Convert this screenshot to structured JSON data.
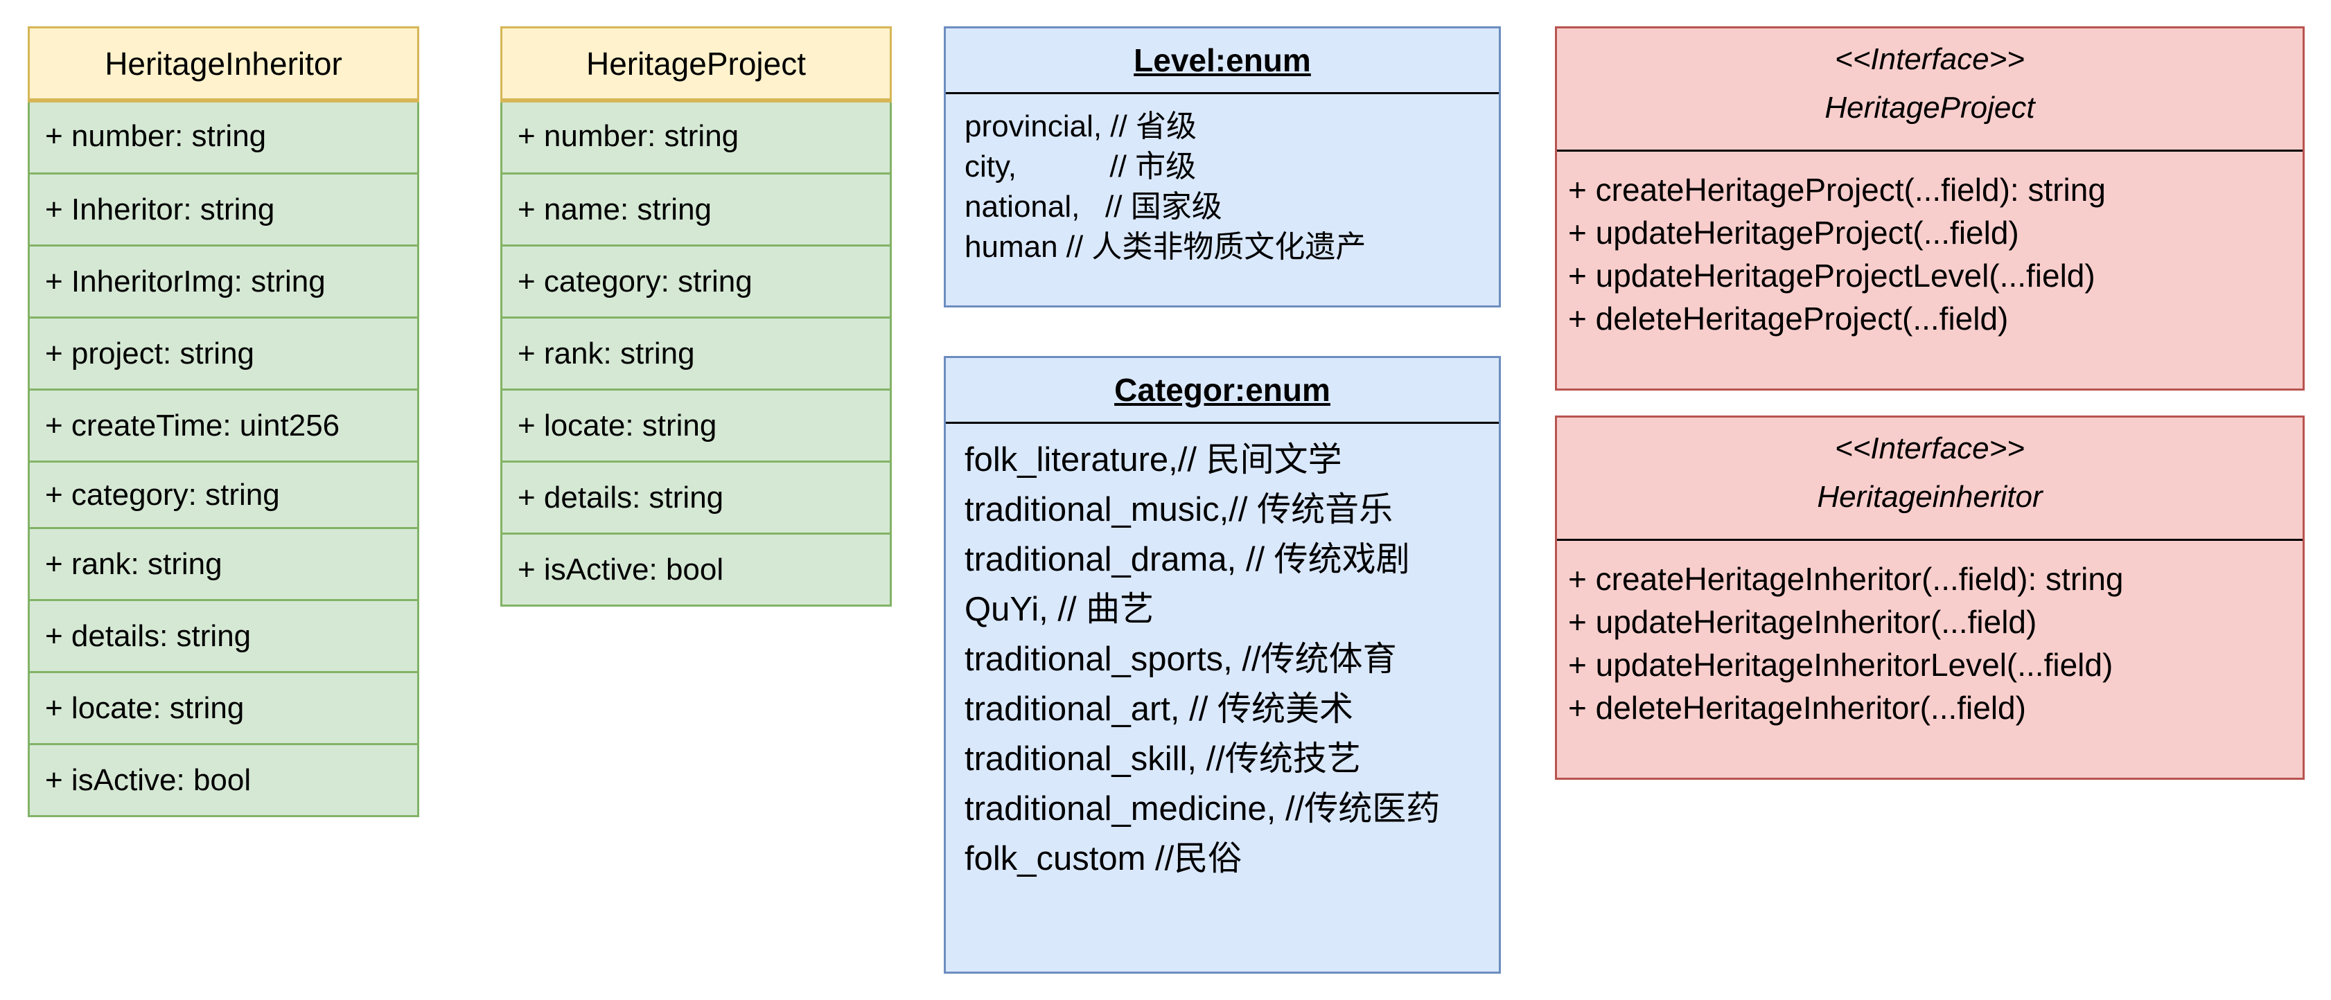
{
  "classes": {
    "inheritor": {
      "name": "HeritageInheritor",
      "attributes": [
        "+ number: string",
        "+ Inheritor: string",
        "+ InheritorImg: string",
        "+ project: string",
        "+ createTime: uint256",
        "+ category: string",
        "+ rank: string",
        "+ details: string",
        "+ locate: string",
        "+ isActive: bool"
      ]
    },
    "project": {
      "name": "HeritageProject",
      "attributes": [
        "+ number: string",
        "+ name: string",
        "+ category: string",
        "+ rank: string",
        "+ locate: string",
        "+ details: string",
        "+ isActive: bool"
      ]
    }
  },
  "enums": {
    "level": {
      "title": "Level:enum",
      "lines": [
        "provincial, // 省级",
        "city,           // 市级",
        "national,   // 国家级",
        "human // 人类非物质文化遗产"
      ]
    },
    "category": {
      "title": "Categor:enum",
      "lines": [
        "folk_literature,// 民间文学",
        "traditional_music,// 传统音乐",
        "traditional_drama, // 传统戏剧",
        "QuYi, // 曲艺",
        "traditional_sports, //传统体育",
        "traditional_art, // 传统美术",
        "traditional_skill, //传统技艺",
        "traditional_medicine, //传统医药",
        "folk_custom //民俗"
      ]
    }
  },
  "interfaces": {
    "project": {
      "stereotype": "<<Interface>>",
      "name": "HeritageProject",
      "methods": [
        "+ createHeritageProject(...field): string",
        "+ updateHeritageProject(...field)",
        "+ updateHeritageProjectLevel(...field)",
        "+ deleteHeritageProject(...field)"
      ]
    },
    "inheritor": {
      "stereotype": "<<Interface>>",
      "name": "Heritageinheritor",
      "methods": [
        "+ createHeritageInheritor(...field): string",
        "+ updateHeritageInheritor(...field)",
        "+ updateHeritageInheritorLevel(...field)",
        "+ deleteHeritageInheritor(...field)"
      ]
    }
  },
  "colors": {
    "class_header_fill": "#fff2cc",
    "class_header_stroke": "#d6b656",
    "class_body_fill": "#d5e8d4",
    "class_body_stroke": "#82b366",
    "enum_fill": "#dae8fc",
    "enum_stroke": "#6c8ebf",
    "interface_fill": "#f8cecc",
    "interface_stroke": "#b85450"
  }
}
